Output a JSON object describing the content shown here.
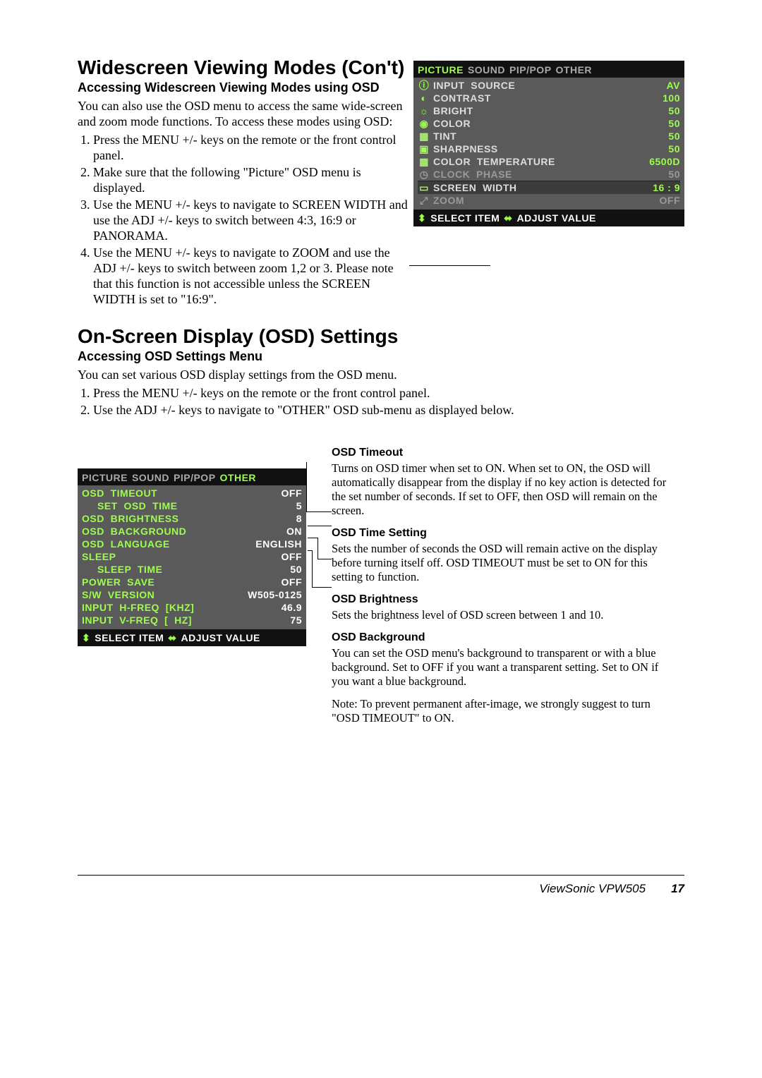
{
  "section1": {
    "heading": "Widescreen Viewing Modes (Con't)",
    "subheading": "Accessing Widescreen Viewing Modes using OSD",
    "intro": "You can also use the OSD menu to access the same wide-screen and zoom mode functions.  To access these modes using OSD:",
    "steps": [
      "Press the MENU +/- keys on the remote or the front control panel.",
      "Make sure that the following \"Picture\" OSD menu is displayed.",
      "Use the MENU +/- keys to navigate to SCREEN WIDTH and use the ADJ +/- keys to switch between 4:3, 16:9 or PANORAMA.",
      "Use the MENU +/- keys to navigate to ZOOM and use the ADJ +/- keys to switch between zoom 1,2 or 3.  Please note that this function is not accessible unless the SCREEN WIDTH is set to \"16:9\"."
    ]
  },
  "osd1": {
    "tabs": [
      "PICTURE",
      "SOUND",
      "PIP/POP",
      "OTHER"
    ],
    "activeTab": 0,
    "rows": [
      {
        "icon": "info-icon",
        "glyph": "ⓘ",
        "label": "INPUT  SOURCE",
        "value": "AV",
        "dim": false,
        "hl": false
      },
      {
        "icon": "contrast-icon",
        "glyph": "◐",
        "label": "CONTRAST",
        "value": "100",
        "dim": false,
        "hl": false
      },
      {
        "icon": "brightness-icon",
        "glyph": "☼",
        "label": "BRIGHT",
        "value": "50",
        "dim": false,
        "hl": false
      },
      {
        "icon": "color-icon",
        "glyph": "◉",
        "label": "COLOR",
        "value": "50",
        "dim": false,
        "hl": false
      },
      {
        "icon": "tint-icon",
        "glyph": "▦",
        "label": "TINT",
        "value": "50",
        "dim": false,
        "hl": false
      },
      {
        "icon": "sharpness-icon",
        "glyph": "▣",
        "label": "SHARPNESS",
        "value": "50",
        "dim": false,
        "hl": false
      },
      {
        "icon": "temperature-icon",
        "glyph": "▦",
        "label": "COLOR  TEMPERATURE",
        "value": "6500D",
        "dim": false,
        "hl": false
      },
      {
        "icon": "clock-icon",
        "glyph": "◷",
        "label": "CLOCK  PHASE",
        "value": "50",
        "dim": true,
        "hl": false
      },
      {
        "icon": "screen-width-icon",
        "glyph": "▭",
        "label": "SCREEN  WIDTH",
        "value": "16 : 9",
        "dim": false,
        "hl": true
      },
      {
        "icon": "zoom-icon",
        "glyph": "⤢",
        "label": "ZOOM",
        "value": "OFF",
        "dim": true,
        "hl": false
      }
    ],
    "footer": {
      "selectLabel": "SELECT  ITEM",
      "adjustLabel": "ADJUST  VALUE"
    }
  },
  "section2": {
    "heading": "On-Screen Display (OSD) Settings",
    "subheading": "Accessing OSD Settings Menu",
    "intro": "You can set various OSD display settings from the OSD menu.",
    "steps": [
      "Press the MENU +/- keys on the remote or the front control panel.",
      "Use the ADJ +/- keys to navigate to \"OTHER\" OSD sub-menu as displayed below."
    ]
  },
  "osd2": {
    "tabs": [
      "PICTURE",
      "SOUND",
      "PIP/POP",
      "OTHER"
    ],
    "activeTab": 3,
    "rows": [
      {
        "label": "OSD  TIMEOUT",
        "value": "OFF"
      },
      {
        "label": "     SET  OSD  TIME",
        "value": "5"
      },
      {
        "label": "OSD  BRIGHTNESS",
        "value": "8"
      },
      {
        "label": "OSD  BACKGROUND",
        "value": "ON"
      },
      {
        "label": "OSD  LANGUAGE",
        "value": "ENGLISH"
      },
      {
        "label": "SLEEP",
        "value": "OFF"
      },
      {
        "label": "     SLEEP  TIME",
        "value": "50"
      },
      {
        "label": "POWER  SAVE",
        "value": "OFF"
      },
      {
        "label": "S/W  VERSION",
        "value": "W505-0125"
      },
      {
        "label": "INPUT  H-FREQ  [KHZ]",
        "value": "46.9"
      },
      {
        "label": "INPUT  V-FREQ  [  HZ]",
        "value": "75"
      }
    ],
    "footer": {
      "selectLabel": "SELECT  ITEM",
      "adjustLabel": "ADJUST  VALUE"
    }
  },
  "callouts": [
    {
      "title": "OSD Timeout",
      "body": "Turns on OSD timer when set to ON.  When set to ON, the OSD will automatically disappear from the display if no key action is detected for the set number of seconds.  If set to OFF, then OSD will remain on the screen."
    },
    {
      "title": "OSD Time Setting",
      "body": "Sets the number of seconds the OSD will remain active on the display before turning itself off.  OSD TIMEOUT must be set to ON for this setting to function."
    },
    {
      "title": "OSD Brightness",
      "body": "Sets the brightness level of OSD screen between 1 and 10."
    },
    {
      "title": "OSD Background",
      "body": "You can set the OSD menu's background to transparent or with a blue background.  Set to OFF if you want a transparent setting.  Set to ON if you want a blue background."
    }
  ],
  "note": "Note:  To prevent permanent after-image, we strongly suggest to turn \"OSD TIMEOUT\" to ON.",
  "footer": {
    "model": "ViewSonic  VPW505",
    "page": "17"
  }
}
